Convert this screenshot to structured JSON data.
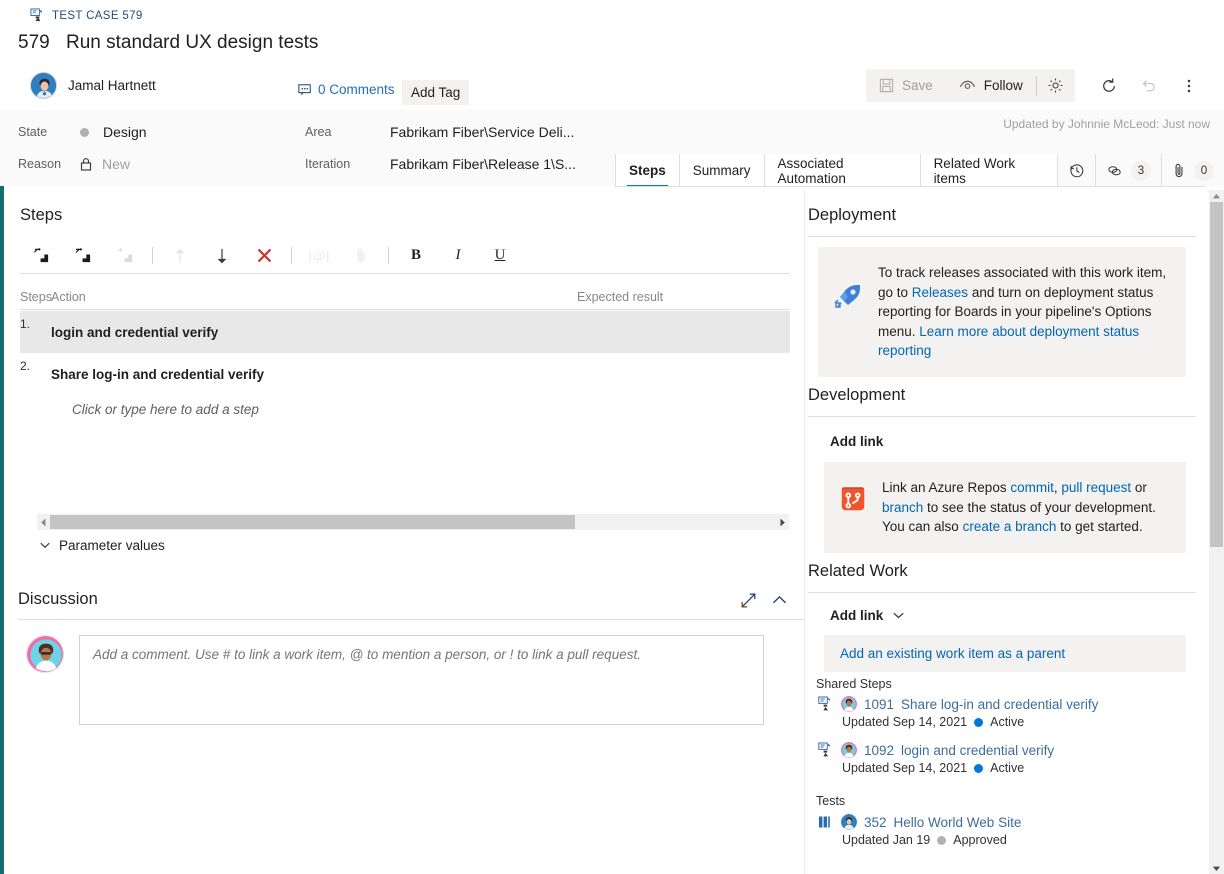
{
  "header": {
    "breadcrumb": "TEST CASE 579",
    "breadcrumb_icon": "test-case-icon",
    "work_item_id": "579",
    "title": "Run standard UX design tests",
    "assignee": "Jamal Hartnett",
    "comments_label": "0 Comments",
    "add_tag_label": "Add Tag",
    "toolbar": {
      "save_label": "Save",
      "follow_label": "Follow",
      "settings_icon": "gear-icon",
      "refresh_icon": "refresh-icon",
      "undo_icon": "undo-icon",
      "more_icon": "more-vertical-icon"
    }
  },
  "fields": {
    "state_label": "State",
    "state_value": "Design",
    "reason_label": "Reason",
    "reason_value": "New",
    "area_label": "Area",
    "area_value": "Fabrikam Fiber\\Service Deli...",
    "iteration_label": "Iteration",
    "iteration_value": "Fabrikam Fiber\\Release 1\\S...",
    "updated_by": "Updated by Johnnie McLeod: Just now"
  },
  "tabs": {
    "items": [
      {
        "label": "Steps",
        "active": true
      },
      {
        "label": "Summary",
        "active": false
      },
      {
        "label": "Associated Automation",
        "active": false
      },
      {
        "label": "Related Work items",
        "active": false
      }
    ],
    "history_icon": "history-clock-icon",
    "links_icon": "links-chain-icon",
    "links_count": "3",
    "attachments_icon": "attachment-paperclip-icon",
    "attachments_count": "0"
  },
  "steps_panel": {
    "heading": "Steps",
    "toolbar": [
      {
        "name": "insert-step-icon",
        "enabled": true
      },
      {
        "name": "insert-shared-step-icon",
        "enabled": true
      },
      {
        "name": "create-shared-step-icon",
        "enabled": false
      },
      {
        "name": "move-up-icon",
        "enabled": false
      },
      {
        "name": "move-down-icon",
        "enabled": true
      },
      {
        "name": "delete-step-icon",
        "enabled": true
      },
      {
        "name": "insert-parameter-icon",
        "enabled": false
      },
      {
        "name": "attach-file-icon",
        "enabled": false
      },
      {
        "name": "bold-icon",
        "enabled": true,
        "text": "B"
      },
      {
        "name": "italic-icon",
        "enabled": true,
        "text": "I"
      },
      {
        "name": "underline-icon",
        "enabled": true,
        "text": "U"
      }
    ],
    "columns": {
      "steps": "Steps",
      "action": "Action",
      "expected": "Expected result"
    },
    "rows": [
      {
        "num": "1.",
        "action": "login and credential verify",
        "expected": "",
        "selected": true
      },
      {
        "num": "2.",
        "action": "Share log-in and credential verify",
        "expected": "",
        "selected": false
      }
    ],
    "add_step_placeholder": "Click or type here to add a step",
    "parameter_values_label": "Parameter values"
  },
  "discussion": {
    "heading": "Discussion",
    "expand_icon": "expand-diagonal-icon",
    "collapse_icon": "chevron-up-icon",
    "comment_placeholder": "Add a comment. Use # to link a work item, @ to mention a person, or ! to link a pull request."
  },
  "deployment": {
    "heading": "Deployment",
    "icon": "azure-pipelines-rocket-icon",
    "text_parts": [
      {
        "t": "To track releases associated with this work item, go to ",
        "link": false
      },
      {
        "t": "Releases",
        "link": true
      },
      {
        "t": " and turn on deployment status reporting for Boards in your pipeline's Options menu. ",
        "link": false
      },
      {
        "t": "Learn more about deployment status reporting",
        "link": true
      }
    ]
  },
  "development": {
    "heading": "Development",
    "add_link_label": "Add link",
    "icon": "azure-repos-icon",
    "text_parts": [
      {
        "t": "Link an Azure Repos ",
        "link": false
      },
      {
        "t": "commit",
        "link": true
      },
      {
        "t": ", ",
        "link": false
      },
      {
        "t": "pull request",
        "link": true
      },
      {
        "t": " or ",
        "link": false
      },
      {
        "t": "branch",
        "link": true
      },
      {
        "t": " to see the status of your development. You can also ",
        "link": false
      },
      {
        "t": "create a branch",
        "link": true
      },
      {
        "t": " to get started.",
        "link": false
      }
    ]
  },
  "related_work": {
    "heading": "Related Work",
    "add_link_label": "Add link",
    "add_link_chevron": "chevron-down-icon",
    "add_parent_label": "Add an existing work item as a parent",
    "groups": [
      {
        "label": "Shared Steps",
        "items": [
          {
            "icon": "shared-steps-icon",
            "id": "1091",
            "title": "Share log-in and credential verify",
            "updated": "Updated Sep 14, 2021",
            "state": "Active",
            "state_color": "#0078d4"
          },
          {
            "icon": "shared-steps-icon",
            "id": "1092",
            "title": "login and credential verify",
            "updated": "Updated Sep 14, 2021",
            "state": "Active",
            "state_color": "#0078d4"
          }
        ]
      },
      {
        "label": "Tests",
        "items": [
          {
            "icon": "test-plan-icon",
            "id": "352",
            "title": "Hello World Web Site",
            "updated": "Updated Jan 19",
            "state": "Approved",
            "state_color": "#b1b1b1"
          }
        ]
      }
    ]
  },
  "colors": {
    "accent_teal": "#136e6e",
    "link_blue": "#0066b4",
    "tab_active": "#0078d4",
    "delete_red": "#d13438",
    "row_selected": "#e8e8e8"
  }
}
